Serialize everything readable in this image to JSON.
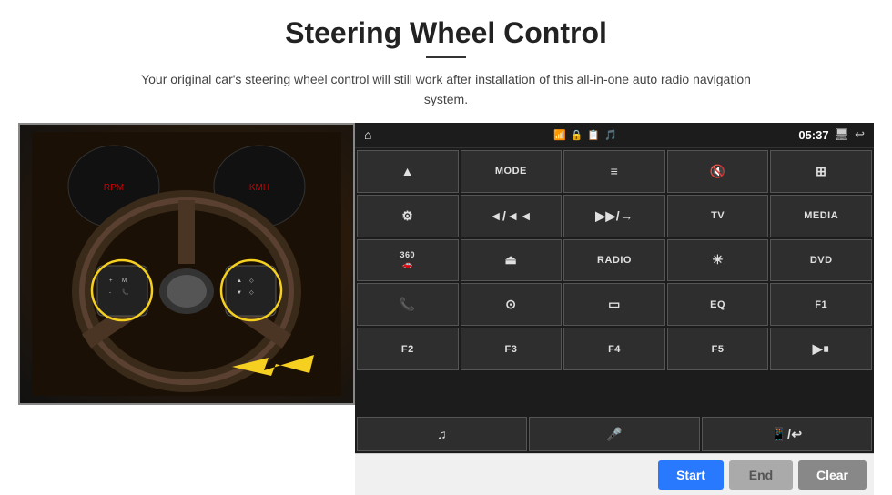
{
  "page": {
    "title": "Steering Wheel Control",
    "subtitle": "Your original car's steering wheel control will still work after installation of this all-in-one auto radio navigation system."
  },
  "status_bar": {
    "time": "05:37",
    "icons": [
      "wifi",
      "lock",
      "battery",
      "bluetooth",
      "screen",
      "back"
    ]
  },
  "buttons": [
    {
      "id": "nav",
      "icon": "▲",
      "text": "",
      "symbol": "nav"
    },
    {
      "id": "mode",
      "icon": "",
      "text": "MODE"
    },
    {
      "id": "list",
      "icon": "≡",
      "text": ""
    },
    {
      "id": "mute",
      "icon": "🔇",
      "text": ""
    },
    {
      "id": "apps",
      "icon": "⊞",
      "text": ""
    },
    {
      "id": "settings",
      "icon": "⚙",
      "text": ""
    },
    {
      "id": "prev",
      "icon": "◄◄",
      "text": ""
    },
    {
      "id": "next",
      "icon": "▶▶",
      "text": ""
    },
    {
      "id": "tv",
      "icon": "",
      "text": "TV"
    },
    {
      "id": "media",
      "icon": "",
      "text": "MEDIA"
    },
    {
      "id": "cam360",
      "icon": "360",
      "text": ""
    },
    {
      "id": "eject",
      "icon": "⏏",
      "text": ""
    },
    {
      "id": "radio",
      "icon": "",
      "text": "RADIO"
    },
    {
      "id": "bright",
      "icon": "☀",
      "text": ""
    },
    {
      "id": "dvd",
      "icon": "",
      "text": "DVD"
    },
    {
      "id": "phone",
      "icon": "📞",
      "text": ""
    },
    {
      "id": "gps",
      "icon": "🧭",
      "text": ""
    },
    {
      "id": "rect",
      "icon": "▭",
      "text": ""
    },
    {
      "id": "eq",
      "icon": "",
      "text": "EQ"
    },
    {
      "id": "f1",
      "icon": "",
      "text": "F1"
    },
    {
      "id": "f2",
      "icon": "",
      "text": "F2"
    },
    {
      "id": "f3",
      "icon": "",
      "text": "F3"
    },
    {
      "id": "f4",
      "icon": "",
      "text": "F4"
    },
    {
      "id": "f5",
      "icon": "",
      "text": "F5"
    },
    {
      "id": "playp",
      "icon": "▶⏸",
      "text": ""
    }
  ],
  "last_row": [
    {
      "id": "music",
      "icon": "♫",
      "text": ""
    },
    {
      "id": "mic",
      "icon": "🎤",
      "text": ""
    },
    {
      "id": "callend",
      "icon": "📱",
      "text": ""
    }
  ],
  "bottom_buttons": {
    "start": "Start",
    "end": "End",
    "clear": "Clear"
  }
}
